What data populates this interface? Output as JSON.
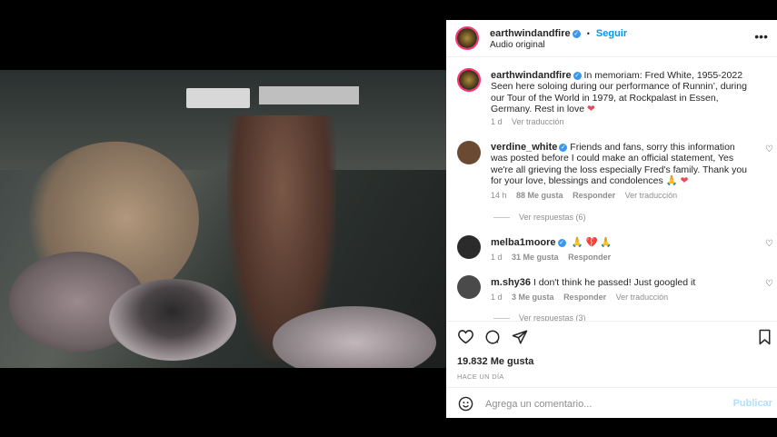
{
  "post": {
    "username": "earthwindandfire",
    "follow_label": "Seguir",
    "audio_label": "Audio original",
    "more_icon": "more-horizontal-icon",
    "separator": "•"
  },
  "caption": {
    "username": "earthwindandfire",
    "text": "In memoriam: Fred White, 1955-2022 Seen here soloing during our performance of Runnin’, during our Tour of the World in 1979, at Rockpalast in Essen, Germany. Rest in love",
    "emoji": "❤",
    "time": "1 d",
    "translate": "Ver traducción"
  },
  "comments": [
    {
      "username": "verdine_white",
      "text": "Friends and fans, sorry this information was posted before I could make an official statement, Yes we're all grieving the loss especially Fred's family. Thank you for your love, blessings and condolences",
      "emoji": "🙏 ❤",
      "time": "14 h",
      "likes": "88 Me gusta",
      "reply": "Responder",
      "translate": "Ver traducción",
      "replies": "Ver respuestas (6)"
    },
    {
      "username": "melba1moore",
      "text": "🙏 💔 🙏",
      "time": "1 d",
      "likes": "31 Me gusta",
      "reply": "Responder"
    },
    {
      "username": "m.shy36",
      "text": "I don't think he passed! Just googled it",
      "time": "1 d",
      "likes": "3 Me gusta",
      "reply": "Responder",
      "translate": "Ver traducción",
      "replies": "Ver respuestas (3)"
    }
  ],
  "actions": {
    "like_icon": "heart-icon",
    "comment_icon": "comment-icon",
    "share_icon": "share-icon",
    "save_icon": "bookmark-icon",
    "likes_count": "19.832 Me gusta",
    "time_ago": "HACE UN DÍA"
  },
  "comment_box": {
    "placeholder": "Agrega un comentario...",
    "publish": "Publicar",
    "emoji_icon": "smiley-icon"
  },
  "video": {
    "mute_icon": "muted-speaker-icon"
  },
  "colors": {
    "link": "#0095f6",
    "verified": "#3897f0",
    "heart": "#ed4956",
    "muted_text": "#8e8e8e"
  }
}
